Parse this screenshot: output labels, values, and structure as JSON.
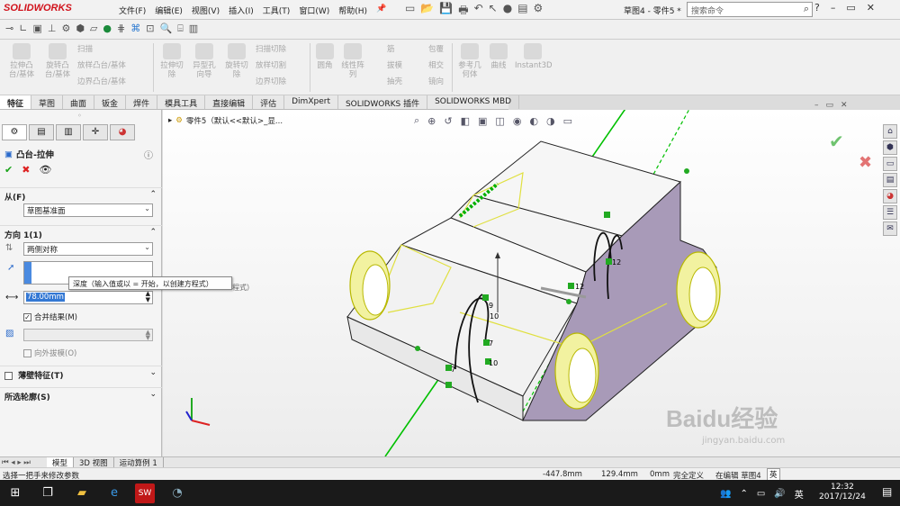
{
  "app": {
    "logo": "SOLIDWORKS",
    "menu": [
      "文件(F)",
      "编辑(E)",
      "视图(V)",
      "插入(I)",
      "工具(T)",
      "窗口(W)",
      "帮助(H)"
    ],
    "doc_title": "草图4 - 零件5 *",
    "search_placeholder": "搜索命令"
  },
  "ribbon": {
    "groups": [
      {
        "label1": "拉伸凸",
        "label2": "台/基体"
      },
      {
        "label1": "旋转凸",
        "label2": "台/基体"
      }
    ],
    "small_items": [
      "扫描",
      "放样凸台/基体",
      "边界凸台/基体"
    ],
    "cut_big": [
      {
        "label1": "拉伸切",
        "label2": "除"
      },
      {
        "label1": "异型孔",
        "label2": "向导"
      },
      {
        "label1": "旋转切",
        "label2": "除"
      }
    ],
    "cut_small": [
      "扫描切除",
      "放样切割",
      "边界切除"
    ],
    "feat_big": [
      {
        "label1": "圆角",
        "label2": ""
      },
      {
        "label1": "线性阵",
        "label2": "列"
      }
    ],
    "feat_small1": [
      "筋",
      "拔模",
      "抽壳"
    ],
    "feat_small2": [
      "包覆",
      "相交",
      "镜向"
    ],
    "ref_big": [
      {
        "label1": "参考几",
        "label2": "何体"
      },
      {
        "label1": "曲线",
        "label2": ""
      },
      {
        "label1": "Instant3D",
        "label2": ""
      }
    ]
  },
  "tabs": [
    {
      "label": "特征",
      "active": true
    },
    {
      "label": "草图",
      "active": false
    },
    {
      "label": "曲面",
      "active": false
    },
    {
      "label": "钣金",
      "active": false
    },
    {
      "label": "焊件",
      "active": false
    },
    {
      "label": "模具工具",
      "active": false
    },
    {
      "label": "直接编辑",
      "active": false
    },
    {
      "label": "评估",
      "active": false
    },
    {
      "label": "DimXpert",
      "active": false
    },
    {
      "label": "SOLIDWORKS 插件",
      "active": false
    },
    {
      "label": "SOLIDWORKS MBD",
      "active": false
    }
  ],
  "property_manager": {
    "title": "凸台-拉伸",
    "from_label": "从(F)",
    "from_value": "草图基准面",
    "direction_label": "方向 1(1)",
    "direction_value": "两侧对称",
    "depth_value": "78.00mm",
    "merge_label": "合并结果(M)",
    "merge_checked": true,
    "draft_label": "向外拔模(O)",
    "thin_label": "薄壁特征(T)",
    "contours_label": "所选轮廓(S)",
    "tooltip": "深度（输入值或以 = 开始，以创建方程式）",
    "tooltip_tail": "程式）"
  },
  "tree": {
    "part_label": "零件5（默认<<默认>_显..."
  },
  "dimensions": [
    "12",
    "12",
    "10",
    "9",
    "7",
    "7",
    "10"
  ],
  "bottom_tabs": [
    {
      "label": "模型",
      "active": true
    },
    {
      "label": "3D 视图",
      "active": false
    },
    {
      "label": "运动算例 1",
      "active": false
    }
  ],
  "status": {
    "message": "选择一把手来修改参数",
    "x": "-447.8mm",
    "y": "129.4mm",
    "z": "0mm",
    "state": "完全定义",
    "editing": "在编辑 草图4",
    "ime": "英"
  },
  "taskbar": {
    "time": "12:32",
    "date": "2017/12/24",
    "ime": "英"
  },
  "watermark": {
    "line1": "Baidu经验",
    "line2": "jingyan.baidu.com"
  },
  "colors": {
    "accent_red": "#d1121b",
    "sketch_green": "#00c000",
    "highlight_yellow": "#f0f060",
    "face_purple": "#a89ab8"
  }
}
